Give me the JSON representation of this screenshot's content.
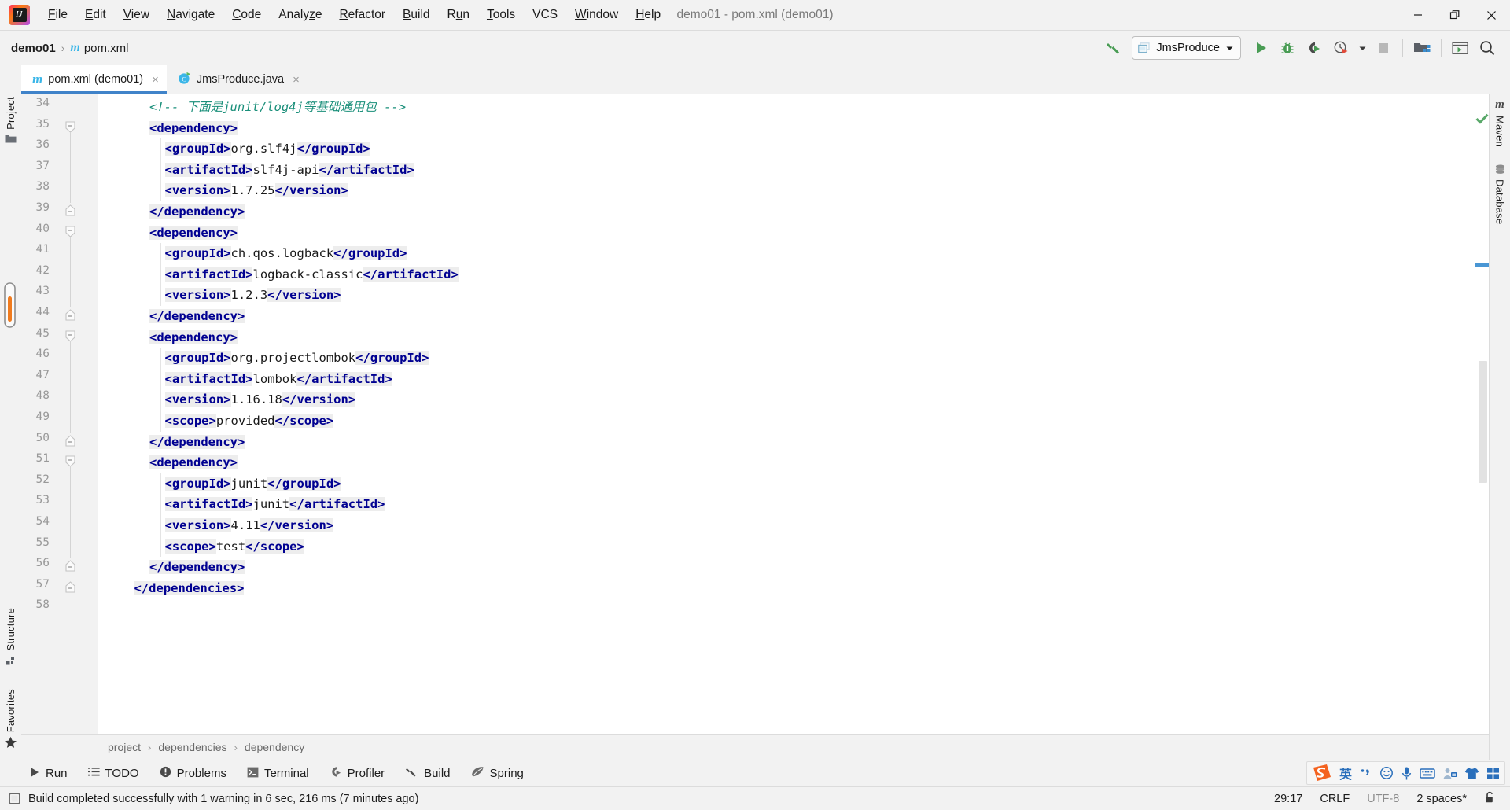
{
  "window": {
    "title": "demo01 - pom.xml (demo01)",
    "controls": {
      "minimize": "minimize-icon",
      "restore": "restore-icon",
      "close": "close-icon"
    }
  },
  "menubar": {
    "items": [
      {
        "label": "File",
        "mnemonic": "F"
      },
      {
        "label": "Edit",
        "mnemonic": "E"
      },
      {
        "label": "View",
        "mnemonic": "V"
      },
      {
        "label": "Navigate",
        "mnemonic": "N"
      },
      {
        "label": "Code",
        "mnemonic": "C"
      },
      {
        "label": "Analyze",
        "mnemonic": "z"
      },
      {
        "label": "Refactor",
        "mnemonic": "R"
      },
      {
        "label": "Build",
        "mnemonic": "B"
      },
      {
        "label": "Run",
        "mnemonic": "u"
      },
      {
        "label": "Tools",
        "mnemonic": "T"
      },
      {
        "label": "VCS",
        "mnemonic": ""
      },
      {
        "label": "Window",
        "mnemonic": "W"
      },
      {
        "label": "Help",
        "mnemonic": "H"
      }
    ]
  },
  "navbar": {
    "project": "demo01",
    "separator": "›",
    "file": "pom.xml",
    "file_icon": "maven-m-icon",
    "run_config": {
      "name": "JmsProduce",
      "icon": "run-config-icon",
      "chevron": "chevron-down-icon"
    },
    "buttons": [
      {
        "name": "build-hammer-button",
        "icon": "hammer-icon"
      },
      {
        "name": "run-button",
        "icon": "play-icon"
      },
      {
        "name": "debug-button",
        "icon": "bug-icon"
      },
      {
        "name": "run-with-coverage-button",
        "icon": "coverage-icon"
      },
      {
        "name": "profiler-button",
        "icon": "clock-play-icon"
      },
      {
        "name": "profiler-dropdown",
        "icon": "chevron-down-icon"
      },
      {
        "name": "stop-button",
        "icon": "stop-square-icon"
      },
      {
        "name": "project-structure-button",
        "icon": "project-structure-icon"
      },
      {
        "name": "terminal-button",
        "icon": "terminal-window-icon"
      },
      {
        "name": "search-everywhere-button",
        "icon": "search-icon"
      }
    ]
  },
  "tabs": [
    {
      "label": "pom.xml (demo01)",
      "icon": "maven-m-icon",
      "active": true,
      "close": "×"
    },
    {
      "label": "JmsProduce.java",
      "icon": "java-class-run-icon",
      "active": false,
      "close": "×"
    }
  ],
  "left_toolbar": [
    {
      "label": "Project",
      "icon": "folder-icon"
    },
    {
      "label": "Structure",
      "icon": "structure-icon"
    },
    {
      "label": "Favorites",
      "icon": "star-icon"
    }
  ],
  "right_toolbar": [
    {
      "label": "Maven",
      "icon": "maven-m-icon"
    },
    {
      "label": "Database",
      "icon": "database-icon"
    }
  ],
  "editor": {
    "first_line": 34,
    "inspection_status": "ok-check-icon",
    "lines": [
      {
        "n": 34,
        "indent": 2,
        "fold": "",
        "tokens": [
          {
            "k": "cm",
            "s": "<!-- 下面是junit/log4j等基础通用包 -->"
          }
        ]
      },
      {
        "n": 35,
        "indent": 2,
        "fold": "minus",
        "tokens": [
          {
            "k": "t",
            "s": "<dependency>"
          }
        ]
      },
      {
        "n": 36,
        "indent": 3,
        "fold": "",
        "tokens": [
          {
            "k": "t",
            "s": "<groupId>"
          },
          {
            "k": "v",
            "s": "org.slf4j"
          },
          {
            "k": "t",
            "s": "</groupId>"
          }
        ]
      },
      {
        "n": 37,
        "indent": 3,
        "fold": "",
        "tokens": [
          {
            "k": "t",
            "s": "<artifactId>"
          },
          {
            "k": "v",
            "s": "slf4j-api"
          },
          {
            "k": "t",
            "s": "</artifactId>"
          }
        ]
      },
      {
        "n": 38,
        "indent": 3,
        "fold": "",
        "tokens": [
          {
            "k": "t",
            "s": "<version>"
          },
          {
            "k": "v",
            "s": "1.7.25"
          },
          {
            "k": "t",
            "s": "</version>"
          }
        ]
      },
      {
        "n": 39,
        "indent": 2,
        "fold": "end",
        "tokens": [
          {
            "k": "t",
            "s": "</dependency>"
          }
        ]
      },
      {
        "n": 40,
        "indent": 2,
        "fold": "minus",
        "tokens": [
          {
            "k": "t",
            "s": "<dependency>"
          }
        ]
      },
      {
        "n": 41,
        "indent": 3,
        "fold": "",
        "tokens": [
          {
            "k": "t",
            "s": "<groupId>"
          },
          {
            "k": "v",
            "s": "ch.qos.logback"
          },
          {
            "k": "t",
            "s": "</groupId>"
          }
        ]
      },
      {
        "n": 42,
        "indent": 3,
        "fold": "",
        "tokens": [
          {
            "k": "t",
            "s": "<artifactId>"
          },
          {
            "k": "v",
            "s": "logback-classic"
          },
          {
            "k": "t",
            "s": "</artifactId>"
          }
        ]
      },
      {
        "n": 43,
        "indent": 3,
        "fold": "",
        "tokens": [
          {
            "k": "t",
            "s": "<version>"
          },
          {
            "k": "v",
            "s": "1.2.3"
          },
          {
            "k": "t",
            "s": "</version>"
          }
        ]
      },
      {
        "n": 44,
        "indent": 2,
        "fold": "end",
        "tokens": [
          {
            "k": "t",
            "s": "</dependency>"
          }
        ]
      },
      {
        "n": 45,
        "indent": 2,
        "fold": "minus",
        "tokens": [
          {
            "k": "t",
            "s": "<dependency>"
          }
        ]
      },
      {
        "n": 46,
        "indent": 3,
        "fold": "",
        "tokens": [
          {
            "k": "t",
            "s": "<groupId>"
          },
          {
            "k": "v",
            "s": "org.projectlombok"
          },
          {
            "k": "t",
            "s": "</groupId>"
          }
        ]
      },
      {
        "n": 47,
        "indent": 3,
        "fold": "",
        "tokens": [
          {
            "k": "t",
            "s": "<artifactId>"
          },
          {
            "k": "v",
            "s": "lombok"
          },
          {
            "k": "t",
            "s": "</artifactId>"
          }
        ]
      },
      {
        "n": 48,
        "indent": 3,
        "fold": "",
        "tokens": [
          {
            "k": "t",
            "s": "<version>"
          },
          {
            "k": "v",
            "s": "1.16.18"
          },
          {
            "k": "t",
            "s": "</version>"
          }
        ]
      },
      {
        "n": 49,
        "indent": 3,
        "fold": "",
        "tokens": [
          {
            "k": "t",
            "s": "<scope>"
          },
          {
            "k": "v",
            "s": "provided"
          },
          {
            "k": "t",
            "s": "</scope>"
          }
        ]
      },
      {
        "n": 50,
        "indent": 2,
        "fold": "end",
        "tokens": [
          {
            "k": "t",
            "s": "</dependency>"
          }
        ]
      },
      {
        "n": 51,
        "indent": 2,
        "fold": "minus",
        "tokens": [
          {
            "k": "t",
            "s": "<dependency>"
          }
        ]
      },
      {
        "n": 52,
        "indent": 3,
        "fold": "",
        "tokens": [
          {
            "k": "t",
            "s": "<groupId>"
          },
          {
            "k": "v",
            "s": "junit"
          },
          {
            "k": "t",
            "s": "</groupId>"
          }
        ]
      },
      {
        "n": 53,
        "indent": 3,
        "fold": "",
        "tokens": [
          {
            "k": "t",
            "s": "<artifactId>"
          },
          {
            "k": "v",
            "s": "junit"
          },
          {
            "k": "t",
            "s": "</artifactId>"
          }
        ]
      },
      {
        "n": 54,
        "indent": 3,
        "fold": "",
        "tokens": [
          {
            "k": "t",
            "s": "<version>"
          },
          {
            "k": "v",
            "s": "4.11"
          },
          {
            "k": "t",
            "s": "</version>"
          }
        ]
      },
      {
        "n": 55,
        "indent": 3,
        "fold": "",
        "tokens": [
          {
            "k": "t",
            "s": "<scope>"
          },
          {
            "k": "v",
            "s": "test"
          },
          {
            "k": "t",
            "s": "</scope>"
          }
        ]
      },
      {
        "n": 56,
        "indent": 2,
        "fold": "end",
        "tokens": [
          {
            "k": "t",
            "s": "</dependency>"
          }
        ]
      },
      {
        "n": 57,
        "indent": 1,
        "fold": "end",
        "tokens": [
          {
            "k": "t",
            "s": "</dependencies>"
          }
        ]
      },
      {
        "n": 58,
        "indent": 0,
        "fold": "",
        "tokens": []
      }
    ]
  },
  "breadcrumbs": {
    "items": [
      "project",
      "dependencies",
      "dependency"
    ],
    "separator": "›"
  },
  "tool_windows": [
    {
      "label": "Run",
      "icon": "play-icon"
    },
    {
      "label": "TODO",
      "icon": "todo-list-icon"
    },
    {
      "label": "Problems",
      "icon": "problems-icon"
    },
    {
      "label": "Terminal",
      "icon": "terminal-icon"
    },
    {
      "label": "Profiler",
      "icon": "profiler-icon"
    },
    {
      "label": "Build",
      "icon": "hammer-icon"
    },
    {
      "label": "Spring",
      "icon": "spring-leaf-icon"
    }
  ],
  "statusbar": {
    "message": "Build completed successfully with 1 warning in 6 sec, 216 ms (7 minutes ago)",
    "message_icon": "build-status-icon",
    "position": "29:17",
    "line_separator": "CRLF",
    "encoding": "UTF-8",
    "indent": "2 spaces*",
    "lock_icon": "unlocked-icon"
  },
  "ime": {
    "logo": "sogou-logo-icon",
    "mode": "英",
    "items": [
      {
        "name": "punctuation-icon",
        "glyph": "•,"
      },
      {
        "name": "emoji-icon",
        "glyph": "☺"
      },
      {
        "name": "voice-input-icon",
        "glyph": "mic"
      },
      {
        "name": "soft-keyboard-icon",
        "glyph": "kbd"
      },
      {
        "name": "user-center-icon",
        "glyph": "user"
      },
      {
        "name": "skin-icon",
        "glyph": "shirt"
      },
      {
        "name": "toolbox-icon",
        "glyph": "grid"
      }
    ]
  },
  "colors": {
    "accent_blue": "#4083c9",
    "tag_blue": "#000091",
    "comment_green": "#1a8f7a",
    "run_green": "#499c54",
    "panel_bg": "#f2f2f2",
    "editor_bg": "#ffffff",
    "ime_orange": "#f4621f"
  }
}
